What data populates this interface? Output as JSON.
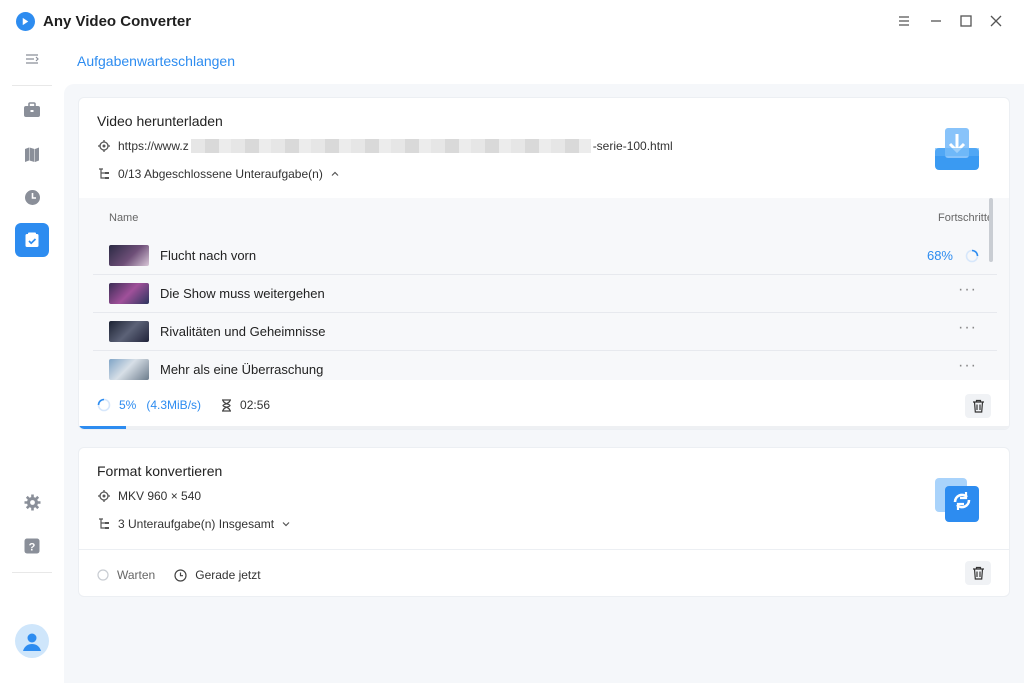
{
  "app": {
    "title": "Any Video Converter"
  },
  "page": {
    "title": "Aufgabenwarteschlangen"
  },
  "colors": {
    "accent": "#2d8cf0"
  },
  "sidebar": {
    "items": [
      {
        "icon": "menu-collapse-icon",
        "active": false
      },
      {
        "icon": "toolbox-icon",
        "active": false
      },
      {
        "icon": "library-icon",
        "active": false
      },
      {
        "icon": "history-clock-icon",
        "active": false
      },
      {
        "icon": "task-queue-icon",
        "active": true
      },
      {
        "icon": "gear-icon",
        "active": false
      },
      {
        "icon": "help-icon",
        "active": false
      },
      {
        "icon": "avatar-icon",
        "active": false
      }
    ]
  },
  "download_task": {
    "title": "Video herunterladen",
    "url_prefix": "https://www.z",
    "url_suffix": "-serie-100.html",
    "subtasks": "0/13 Abgeschlossene Unteraufgabe(n)",
    "columns": {
      "name": "Name",
      "progress": "Fortschritte"
    },
    "rows": [
      {
        "name": "Flucht nach vorn",
        "progress": "68%",
        "more": ""
      },
      {
        "name": "Die Show muss weitergehen",
        "progress": "",
        "more": "···"
      },
      {
        "name": "Rivalitäten und Geheimnisse",
        "progress": "",
        "more": "···"
      },
      {
        "name": "Mehr als eine Überraschung",
        "progress": "",
        "more": "···"
      }
    ],
    "progress_value": 0.05,
    "progress_text": "5%",
    "speed": "(4.3MiB/s)",
    "eta": "02:56"
  },
  "convert_task": {
    "title": "Format konvertieren",
    "format": "MKV 960 × 540",
    "subtasks": "3 Unteraufgabe(n) Insgesamt",
    "status": "Warten",
    "time": "Gerade jetzt"
  }
}
